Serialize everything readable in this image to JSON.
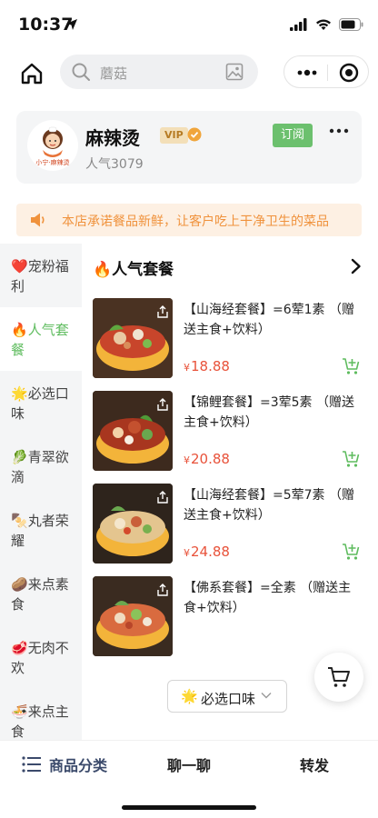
{
  "status_bar": {
    "time": "10:37"
  },
  "search": {
    "placeholder": "蘑菇"
  },
  "shop": {
    "logo_text": "小宁·麻辣烫",
    "name": "麻辣烫",
    "vip_badge": "VIP",
    "popularity": "人气3079",
    "subscribe_label": "订阅"
  },
  "notice": {
    "text": "本店承诺餐品新鲜，让客户吃上干净卫生的菜品"
  },
  "sidebar": {
    "items": [
      {
        "emoji": "❤️",
        "label": "宠粉福利",
        "active": false
      },
      {
        "emoji": "🔥",
        "label": "人气套餐",
        "active": true
      },
      {
        "emoji": "🌟",
        "label": "必选口味",
        "active": false
      },
      {
        "emoji": "🥬",
        "label": "青翠欲滴",
        "active": false
      },
      {
        "emoji": "🍢",
        "label": "丸者荣耀",
        "active": false
      },
      {
        "emoji": "🥔",
        "label": "来点素食",
        "active": false
      },
      {
        "emoji": "🥩",
        "label": "无肉不欢",
        "active": false
      },
      {
        "emoji": "🍜",
        "label": "来点主食",
        "active": false
      }
    ]
  },
  "section": {
    "emoji": "🔥",
    "title": "人气套餐"
  },
  "items": [
    {
      "name": "【山海经套餐】=6荤1素 （赠送主食+饮料）",
      "currency": "¥",
      "price": "18.88"
    },
    {
      "name": "【锦鲤套餐】=3荤5素 （赠送主食+饮料）",
      "currency": "¥",
      "price": "20.88"
    },
    {
      "name": "【山海经套餐】=5荤7素 （赠送主食+饮料）",
      "currency": "¥",
      "price": "24.88"
    },
    {
      "name": "【佛系套餐】=全素 （赠送主食+饮料）",
      "currency": "¥",
      "price": ""
    }
  ],
  "floating_chip": {
    "emoji": "🌟",
    "label": "必选口味"
  },
  "bottom_bar": {
    "category": "商品分类",
    "chat": "聊一聊",
    "share": "转发"
  },
  "colors": {
    "accent_green": "#6cc06e",
    "price_red": "#e8523a",
    "notice_orange": "#f0923c"
  }
}
